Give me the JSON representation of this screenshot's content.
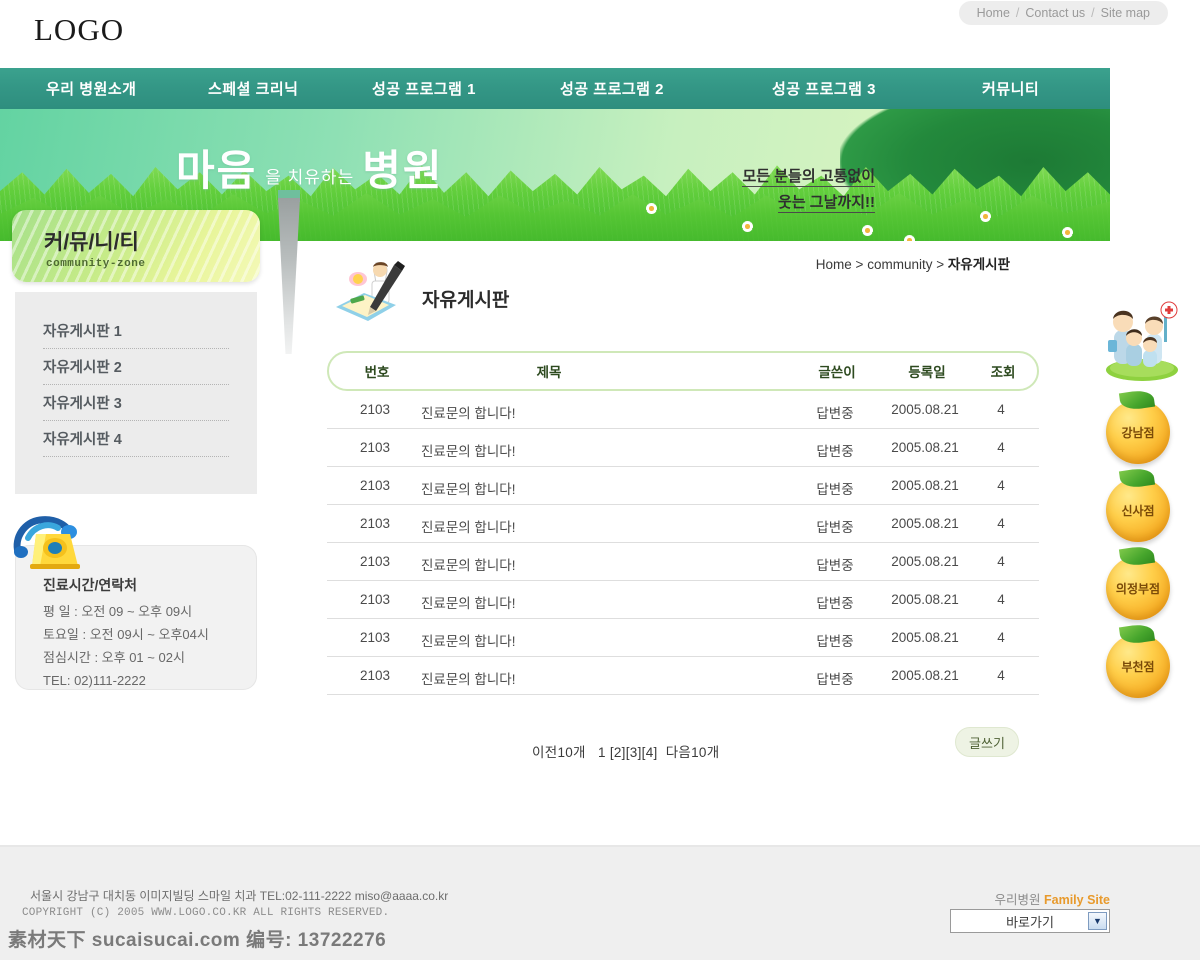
{
  "brand": {
    "logo": "LOGO"
  },
  "utility_nav": {
    "items": [
      "Home",
      "Contact us",
      "Site map"
    ],
    "separator": "/"
  },
  "main_nav": {
    "items": [
      "우리 병원소개",
      "스페셜 크리닉",
      "성공 프로그램 1",
      "성공 프로그램 2",
      "성공 프로그램 3",
      "커뮤니티"
    ]
  },
  "hero": {
    "title_big_1": "마음",
    "title_small": "을 치유하는",
    "title_big_2": "병원",
    "slogan_line1": "모든 분들의 고통없이",
    "slogan_line2": "웃는 그날까지!!"
  },
  "sidebar": {
    "head_title": "커/뮤/니/티",
    "head_sub": "community-zone",
    "menu": [
      "자유게시판 1",
      "자유게시판 2",
      "자유게시판 3",
      "자유게시판 4"
    ],
    "info": {
      "icon": "telephone-icon",
      "title": "진료시간/연락처",
      "line1": "평  일 : 오전 09 ~ 오후 09시",
      "line2": "토요일 : 오전 09시 ~ 오후04시",
      "line3": "점심시간 : 오후 01 ~ 02시",
      "line4": "TEL: 02)111-2222"
    }
  },
  "content": {
    "breadcrumb": {
      "home": "Home",
      "sep1": ">",
      "section": "community",
      "sep2": ">",
      "current": "자유게시판"
    },
    "page_icon": "notepad-pen-doctor-icon",
    "page_title": "자유게시판",
    "board": {
      "columns": [
        "번호",
        "제목",
        "글쓴이",
        "등록일",
        "조회"
      ],
      "rows": [
        {
          "no": "2103",
          "title": "진료문의 합니다!",
          "author": "답변중",
          "date": "2005.08.21",
          "hits": "4"
        },
        {
          "no": "2103",
          "title": "진료문의 합니다!",
          "author": "답변중",
          "date": "2005.08.21",
          "hits": "4"
        },
        {
          "no": "2103",
          "title": "진료문의 합니다!",
          "author": "답변중",
          "date": "2005.08.21",
          "hits": "4"
        },
        {
          "no": "2103",
          "title": "진료문의 합니다!",
          "author": "답변중",
          "date": "2005.08.21",
          "hits": "4"
        },
        {
          "no": "2103",
          "title": "진료문의 합니다!",
          "author": "답변중",
          "date": "2005.08.21",
          "hits": "4"
        },
        {
          "no": "2103",
          "title": "진료문의 합니다!",
          "author": "답변중",
          "date": "2005.08.21",
          "hits": "4"
        },
        {
          "no": "2103",
          "title": "진료문의 합니다!",
          "author": "답변중",
          "date": "2005.08.21",
          "hits": "4"
        },
        {
          "no": "2103",
          "title": "진료문의 합니다!",
          "author": "답변중",
          "date": "2005.08.21",
          "hits": "4"
        }
      ]
    },
    "pagination": {
      "prev": "이전10개",
      "pages": [
        "1",
        "[2]",
        "[3]",
        "[4]"
      ],
      "next": "다음10개",
      "current_page": "1"
    },
    "write_button": "글쓰기"
  },
  "rightbar": {
    "family_illustration": "family-characters-icon",
    "branches": [
      "강남점",
      "신사점",
      "의정부점",
      "부천점"
    ]
  },
  "footer": {
    "address": "서울시 강남구 대치동 이미지빌딩 스마일 치과   TEL:02-111-2222  miso@aaaa.co.kr",
    "copyright": "COPYRIGHT (C) 2005 WWW.LOGO.CO.KR   ALL RIGHTS RESERVED.",
    "watermark": "素材天下 sucaisucai.com  编号: 13722276",
    "family_site_kr": "우리병원",
    "family_site_en": "Family Site",
    "select_value": "바로가기"
  },
  "colors": {
    "nav_teal": "#2e8e7e",
    "hero_green": "#8ce4b7",
    "grass_green": "#4ec233",
    "accent_orange": "#e89a2c",
    "orange_button": "#ffcf4a",
    "board_border": "#cfe8b8",
    "footer_bg": "#efefef"
  }
}
